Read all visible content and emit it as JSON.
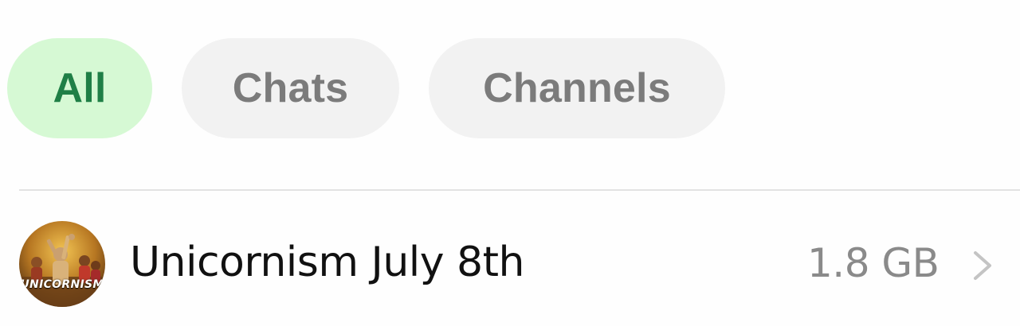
{
  "filters": {
    "all_label": "All",
    "chats_label": "Chats",
    "channels_label": "Channels",
    "active": "All"
  },
  "storage_list": {
    "items": [
      {
        "title": "Unicornism July 8th",
        "size": "1.8 GB",
        "avatar_caption": "UNICORNISM",
        "avatar_icon": "group-photo-avatar"
      }
    ]
  },
  "colors": {
    "active_chip_bg": "#d6f9d4",
    "active_chip_text": "#1f7f46",
    "chip_bg": "#f2f2f2",
    "chip_text": "#7b7b7b"
  }
}
